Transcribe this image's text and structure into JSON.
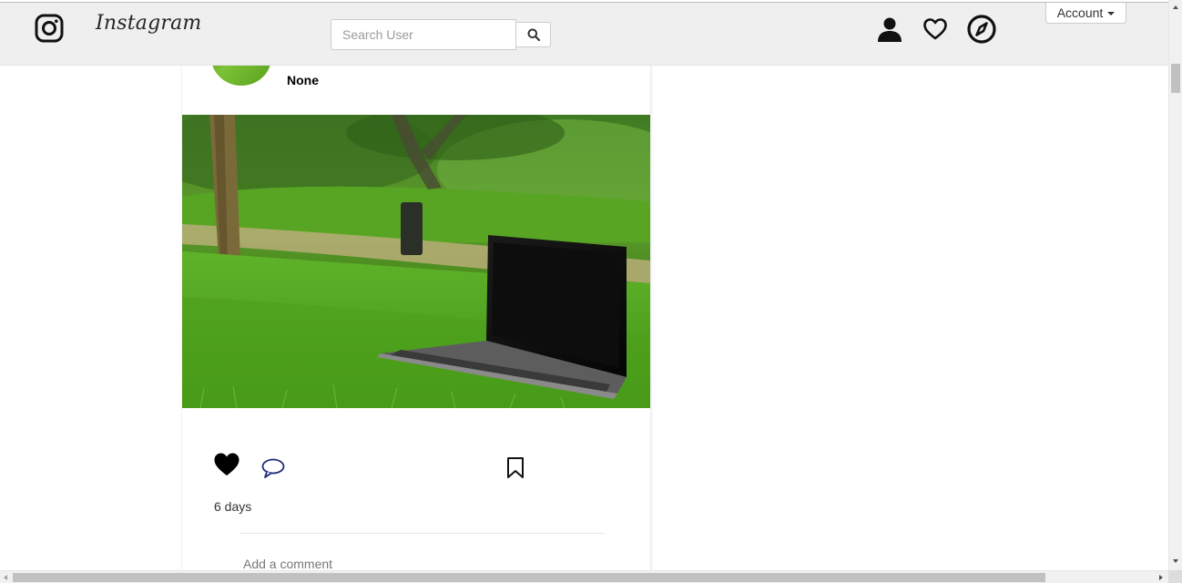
{
  "navbar": {
    "logo_icon": "instagram-glyph",
    "brand": "Instagram",
    "search": {
      "placeholder": "Search User",
      "value": "",
      "button_icon": "search-icon"
    },
    "icons": [
      "profile-icon",
      "heart-icon",
      "compass-icon"
    ],
    "account_label": "Account"
  },
  "post": {
    "username": "None",
    "image_subject": "laptop on grass",
    "actions": {
      "like_icon": "heart-filled-icon",
      "comment_icon": "comment-icon",
      "save_icon": "bookmark-icon"
    },
    "time": "6 days",
    "comment_placeholder": "Add a comment"
  }
}
